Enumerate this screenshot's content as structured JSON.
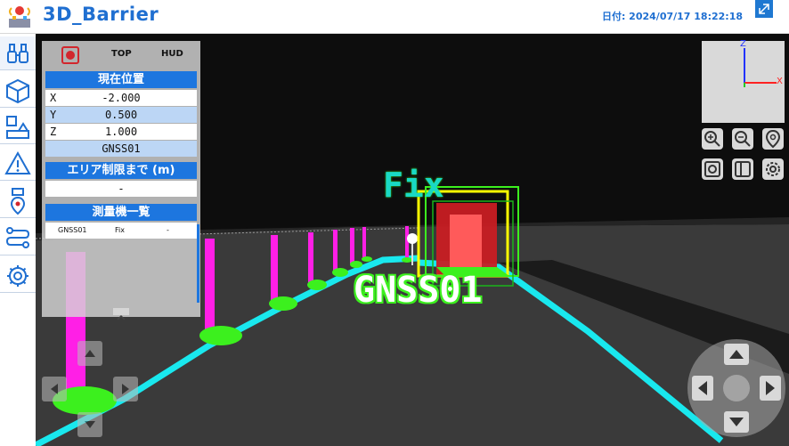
{
  "app": {
    "title": "3D_Barrier",
    "datetime": "日付: 2024/07/17 18:22:18"
  },
  "sidebar": {
    "items": [
      {
        "icon": "binoculars-icon"
      },
      {
        "icon": "cube-icon"
      },
      {
        "icon": "layout-icon"
      },
      {
        "icon": "warning-icon"
      },
      {
        "icon": "route-pin-icon"
      },
      {
        "icon": "path-icon"
      },
      {
        "icon": "gear-icon"
      }
    ]
  },
  "panel": {
    "tabs": {
      "top": "TOP",
      "hud": "HUD"
    },
    "position": {
      "header": "現在位置",
      "x_label": "X",
      "x_value": "-2.000",
      "y_label": "Y",
      "y_value": "0.500",
      "z_label": "Z",
      "z_value": "1.000",
      "device": "GNSS01"
    },
    "area": {
      "header": "エリア制限まで (m)",
      "value": "-"
    },
    "survey": {
      "header": "測量機一覧",
      "rows": [
        {
          "name": "GNSS01",
          "status": "Fix",
          "extra": "-"
        }
      ]
    }
  },
  "scene": {
    "fix_label": "Fix",
    "device_label": "GNSS01",
    "axes": {
      "z": "Z",
      "x": "X"
    }
  },
  "colors": {
    "accent": "#1f6fd1",
    "line": "#19e8ee",
    "pole": "#ff1fe6",
    "base": "#3cf01e"
  }
}
